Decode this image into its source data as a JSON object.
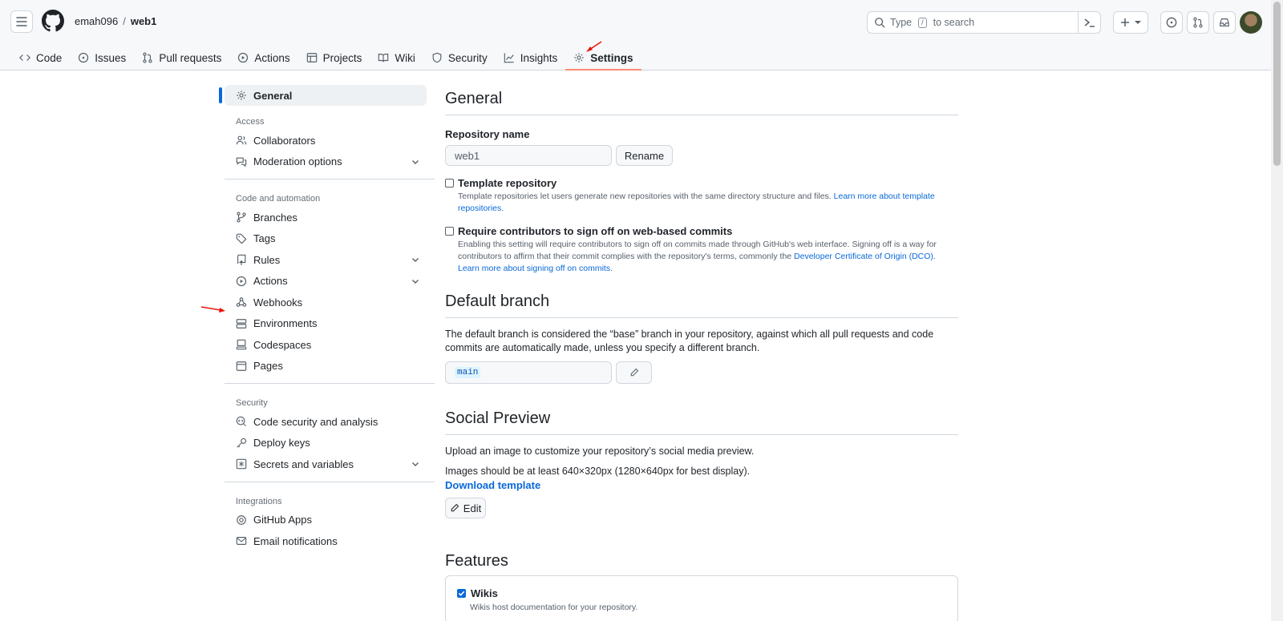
{
  "header": {
    "owner": "emah096",
    "separator": "/",
    "repo": "web1",
    "search_prefix": "Type",
    "search_key": "/",
    "search_suffix": "to search"
  },
  "tabs": [
    {
      "label": "Code",
      "icon": "code-icon"
    },
    {
      "label": "Issues",
      "icon": "issue-icon"
    },
    {
      "label": "Pull requests",
      "icon": "pull-request-icon"
    },
    {
      "label": "Actions",
      "icon": "play-icon"
    },
    {
      "label": "Projects",
      "icon": "table-icon"
    },
    {
      "label": "Wiki",
      "icon": "book-icon"
    },
    {
      "label": "Security",
      "icon": "shield-icon"
    },
    {
      "label": "Insights",
      "icon": "graph-icon"
    },
    {
      "label": "Settings",
      "icon": "gear-icon",
      "active": true
    }
  ],
  "sidebar": {
    "general": "General",
    "access_heading": "Access",
    "access": [
      "Collaborators",
      "Moderation options"
    ],
    "code_heading": "Code and automation",
    "code": [
      "Branches",
      "Tags",
      "Rules",
      "Actions",
      "Webhooks",
      "Environments",
      "Codespaces",
      "Pages"
    ],
    "security_heading": "Security",
    "security": [
      "Code security and analysis",
      "Deploy keys",
      "Secrets and variables"
    ],
    "integrations_heading": "Integrations",
    "integrations": [
      "GitHub Apps",
      "Email notifications"
    ]
  },
  "main": {
    "general_title": "General",
    "repo_name_label": "Repository name",
    "repo_name_value": "web1",
    "rename_button": "Rename",
    "template_label": "Template repository",
    "template_note": "Template repositories let users generate new repositories with the same directory structure and files.",
    "template_link": "Learn more about template repositories.",
    "signoff_label": "Require contributors to sign off on web-based commits",
    "signoff_note_1": "Enabling this setting will require contributors to sign off on commits made through GitHub's web interface. Signing off is a way for contributors to affirm that their commit complies with the repository's terms, commonly the",
    "signoff_link_1": "Developer Certificate of Origin (DCO).",
    "signoff_link_2": "Learn more about signing off on commits",
    "signoff_end": ".",
    "default_branch_title": "Default branch",
    "default_branch_desc": "The default branch is considered the “base” branch in your repository, against which all pull requests and code commits are automatically made, unless you specify a different branch.",
    "default_branch_value": "main",
    "social_title": "Social Preview",
    "social_desc": "Upload an image to customize your repository’s social media preview.",
    "social_size": "Images should be at least 640×320px (1280×640px for best display).",
    "download_template": "Download template",
    "edit_button": "Edit",
    "features_title": "Features",
    "wikis_label": "Wikis",
    "wikis_note": "Wikis host documentation for your repository."
  },
  "colors": {
    "accent": "#0969da",
    "active_tab_underline": "#fd8c73",
    "annotation_arrow": "#e8140c"
  }
}
